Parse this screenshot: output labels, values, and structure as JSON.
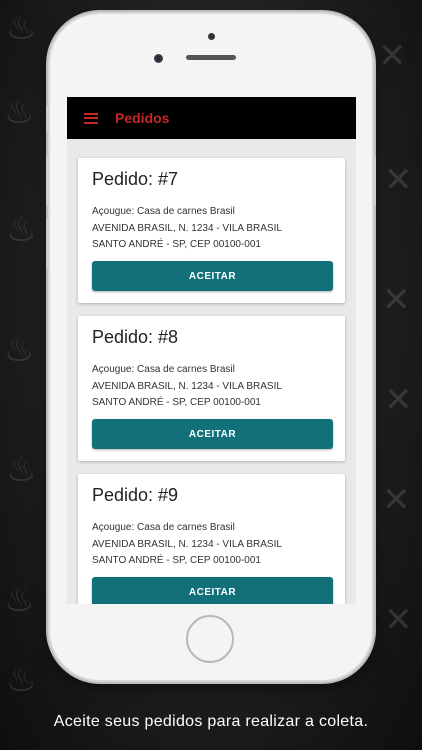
{
  "appbar": {
    "menu_icon": "hamburger-menu-icon",
    "title": "Pedidos",
    "accent_color": "#c62828"
  },
  "orders": [
    {
      "title": "Pedido: #7",
      "shop": "Açougue: Casa de carnes Brasil",
      "address_line1": "AVENIDA BRASIL, N. 1234 - VILA BRASIL",
      "address_line2": "SANTO ANDRÉ - SP, CEP 00100-001",
      "button_label": "ACEITAR"
    },
    {
      "title": "Pedido: #8",
      "shop": "Açougue: Casa de carnes Brasil",
      "address_line1": "AVENIDA BRASIL, N. 1234 - VILA BRASIL",
      "address_line2": "SANTO ANDRÉ - SP, CEP 00100-001",
      "button_label": "ACEITAR"
    },
    {
      "title": "Pedido: #9",
      "shop": "Açougue: Casa de carnes Brasil",
      "address_line1": "AVENIDA BRASIL, N. 1234 - VILA BRASIL",
      "address_line2": "SANTO ANDRÉ - SP, CEP 00100-001",
      "button_label": "ACEITAR"
    }
  ],
  "button_color": "#11707a",
  "caption": "Aceite seus pedidos para realizar a coleta."
}
